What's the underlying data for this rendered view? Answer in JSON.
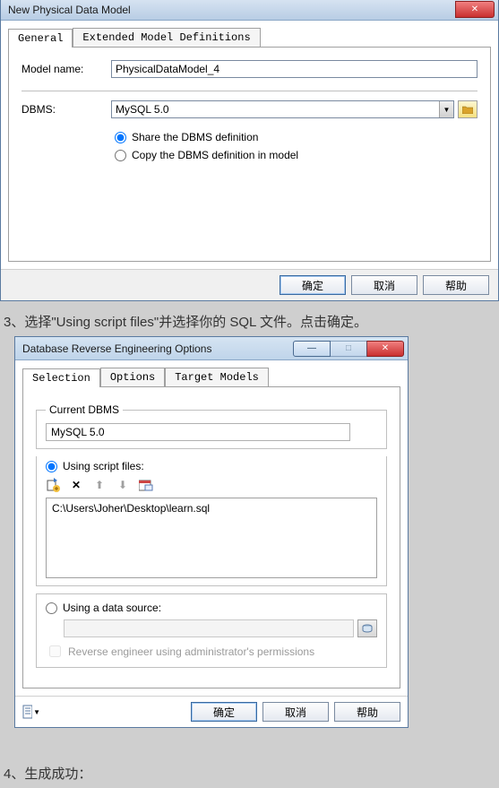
{
  "dialog1": {
    "title": "New Physical Data Model",
    "tabs": [
      "General",
      "Extended Model Definitions"
    ],
    "model_name_label": "Model name:",
    "model_name_value": "PhysicalDataModel_4",
    "dbms_label": "DBMS:",
    "dbms_value": "MySQL 5.0",
    "radio_share": "Share the DBMS definition",
    "radio_copy": "Copy the DBMS definition in model",
    "buttons": {
      "ok": "确定",
      "cancel": "取消",
      "help": "帮助"
    }
  },
  "annotation1": "3、选择\"Using script files\"并选择你的 SQL 文件。点击确定。",
  "dialog2": {
    "title": "Database Reverse Engineering Options",
    "tabs": [
      "Selection",
      "Options",
      "Target Models"
    ],
    "current_dbms_legend": "Current DBMS",
    "current_dbms_value": "MySQL 5.0",
    "using_script_label": "Using script files:",
    "file_path": "C:\\Users\\Joher\\Desktop\\learn.sql",
    "using_ds_label": "Using a data source:",
    "chk_admin": "Reverse engineer using administrator's permissions",
    "buttons": {
      "ok": "确定",
      "cancel": "取消",
      "help": "帮助"
    }
  },
  "annotation2": "4、生成成功："
}
